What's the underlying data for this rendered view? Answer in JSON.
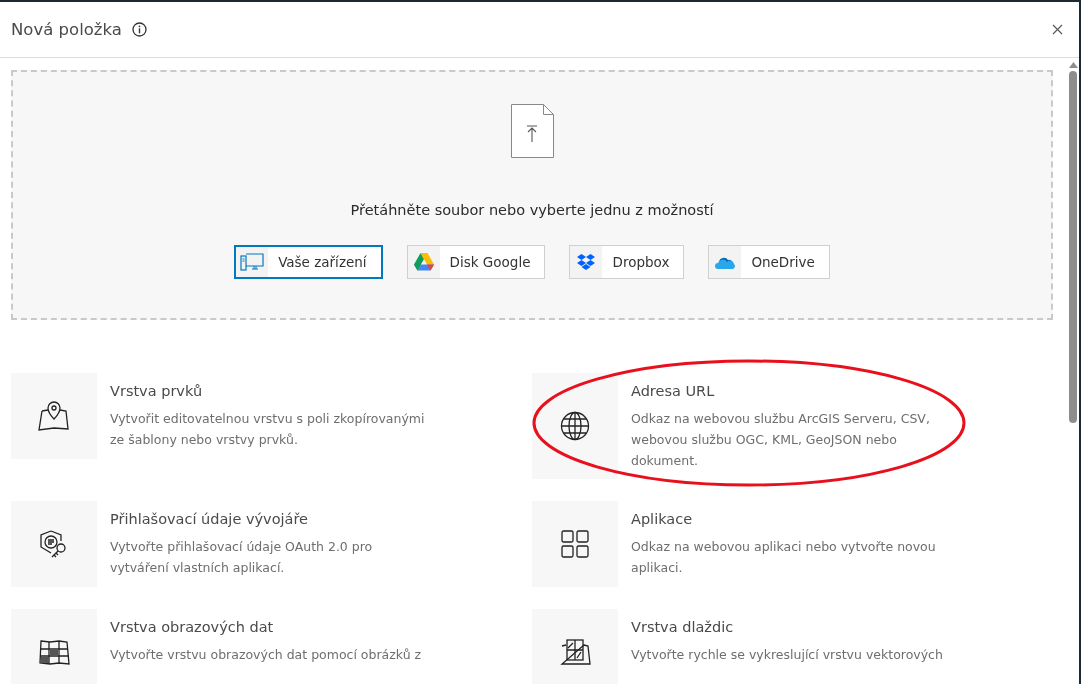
{
  "dialog": {
    "title": "Nová položka"
  },
  "upload": {
    "prompt": "Přetáhněte soubor nebo vyberte jednu z možností",
    "sources": [
      {
        "kind": "device",
        "label": "Vaše zařízení",
        "focused": true
      },
      {
        "kind": "google",
        "label": "Disk Google",
        "focused": false
      },
      {
        "kind": "dropbox",
        "label": "Dropbox",
        "focused": false
      },
      {
        "kind": "onedrive",
        "label": "OneDrive",
        "focused": false
      }
    ]
  },
  "items": [
    {
      "kind": "feature-layer",
      "title": "Vrstva prvků",
      "description": "Vytvořit editovatelnou vrstvu s poli zkopírovanými ze šablony nebo vrstvy prvků.",
      "highlighted": false
    },
    {
      "kind": "url",
      "title": "Adresa URL",
      "description": "Odkaz na webovou službu ArcGIS Serveru, CSV, webovou službu OGC, KML, GeoJSON nebo dokument.",
      "highlighted": true
    },
    {
      "kind": "credentials",
      "title": "Přihlašovací údaje vývojáře",
      "description": "Vytvořte přihlašovací údaje OAuth 2.0 pro vytváření vlastních aplikací.",
      "highlighted": false
    },
    {
      "kind": "app",
      "title": "Aplikace",
      "description": "Odkaz na webovou aplikaci nebo vytvořte novou aplikaci.",
      "highlighted": false
    },
    {
      "kind": "imagery",
      "title": "Vrstva obrazových dat",
      "description": "Vytvořte vrstvu obrazových dat pomocí obrázků z",
      "highlighted": false
    },
    {
      "kind": "tiles",
      "title": "Vrstva dlaždic",
      "description": "Vytvořte rychle se vykreslující vrstvu vektorových",
      "highlighted": false
    }
  ]
}
